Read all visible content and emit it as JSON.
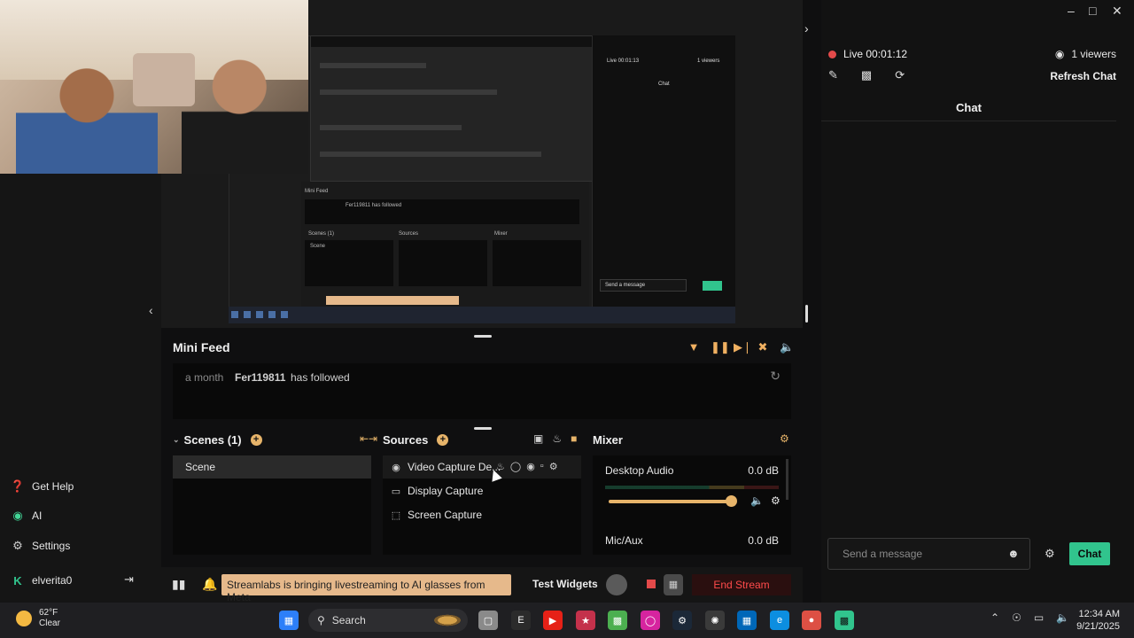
{
  "sidebar": {
    "items": [
      {
        "label": "Get Help",
        "icon": "help-icon"
      },
      {
        "label": "AI",
        "icon": "eye-icon"
      },
      {
        "label": "Settings",
        "icon": "gear-icon"
      }
    ],
    "user": {
      "name": "elverita0",
      "icon": "kick-logo-icon"
    }
  },
  "preview": {
    "mini": {
      "minifeed": "Mini Feed",
      "follow": "Fer119811 has followed",
      "scenes": "Scenes (1)",
      "sources": "Sources",
      "mixer": "Mixer",
      "scene": "Scene",
      "live": "Live 00:01:13",
      "viewers": "1 viewers",
      "chat": "Chat",
      "send": "Send a message"
    }
  },
  "minifeed": {
    "title": "Mini Feed",
    "event": {
      "time": "a month",
      "name": "Fer119811",
      "message": "has followed"
    }
  },
  "scenes": {
    "title": "Scenes (1)",
    "items": [
      "Scene"
    ]
  },
  "sources": {
    "title": "Sources",
    "items": [
      {
        "label": "Video Capture De...",
        "icon": "webcam-icon"
      },
      {
        "label": "Display Capture",
        "icon": "monitor-icon"
      },
      {
        "label": "Screen Capture",
        "icon": "screen-region-icon"
      }
    ]
  },
  "mixer": {
    "title": "Mixer",
    "channels": [
      {
        "name": "Desktop Audio",
        "level": "0.0 dB",
        "volume_fraction": 0.9
      },
      {
        "name": "Mic/Aux",
        "level": "0.0 dB"
      }
    ]
  },
  "bottom": {
    "announcement": "Streamlabs is bringing livestreaming to AI glasses from Meta",
    "test_widgets": "Test Widgets",
    "end_stream": "End Stream"
  },
  "chat": {
    "live": "Live 00:01:12",
    "viewers": "1 viewers",
    "refresh": "Refresh Chat",
    "title": "Chat",
    "placeholder": "Send a message",
    "send_label": "Chat"
  },
  "taskbar": {
    "weather_temp": "62°F",
    "weather_desc": "Clear",
    "search": "Search",
    "time": "12:34 AM",
    "date": "9/21/2025"
  },
  "colors": {
    "accent": "#31c48d",
    "gold": "#e7b46a",
    "danger": "#e34a4a"
  }
}
